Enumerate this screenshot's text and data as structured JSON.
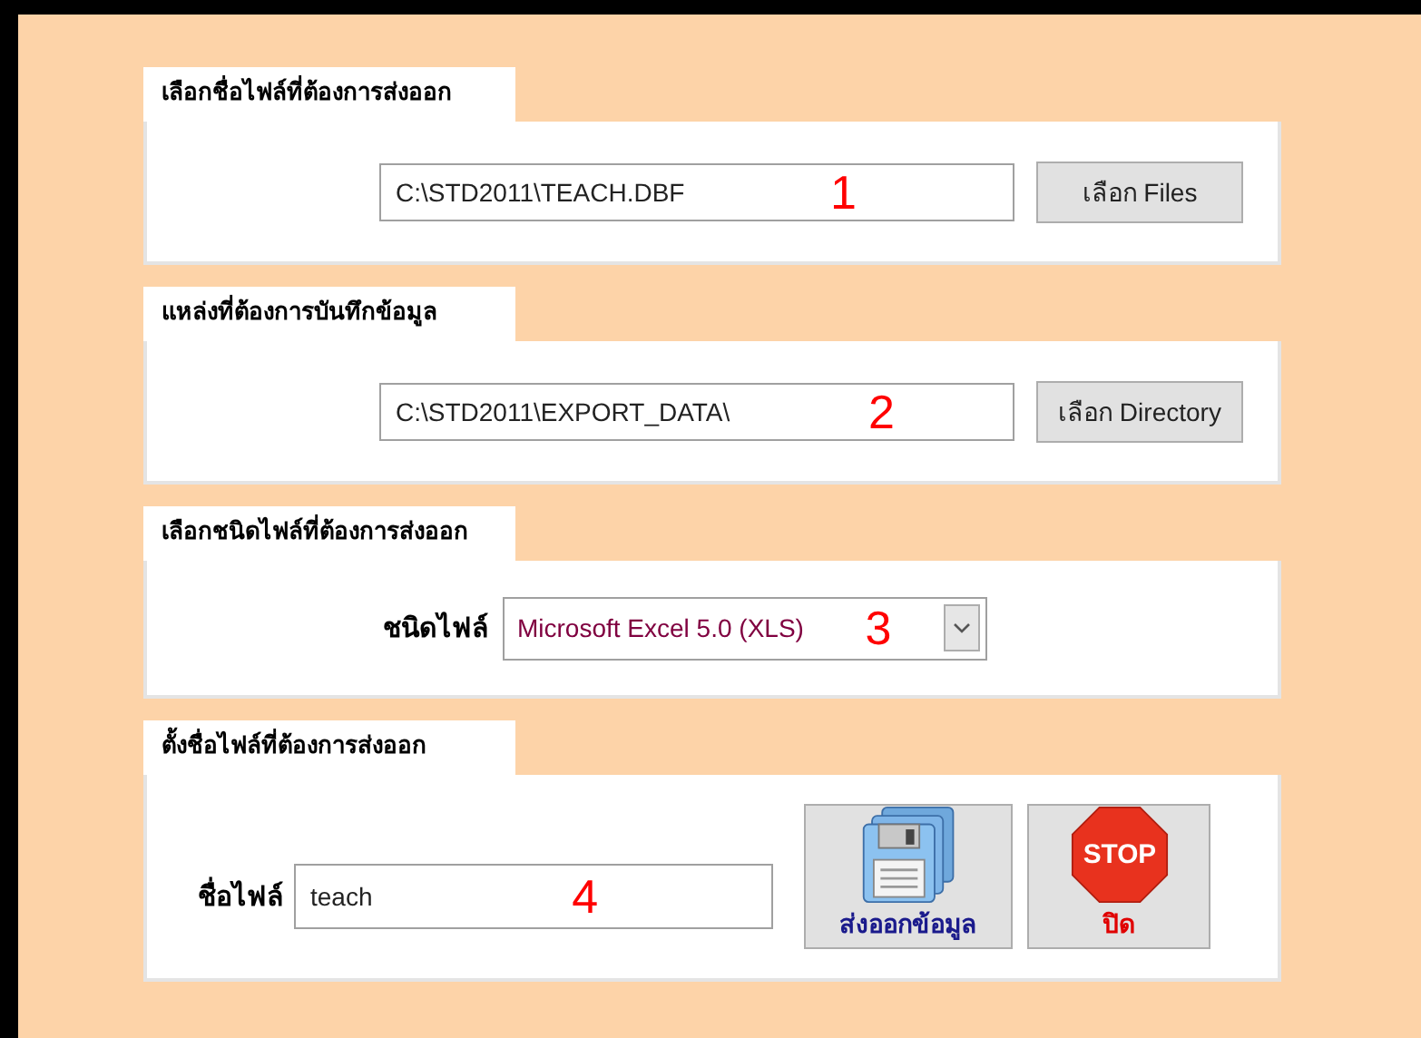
{
  "sections": [
    {
      "kind": "file-field",
      "tab": "เลือกชื่อไฟล์ที่ต้องการส่งออก",
      "value": "C:\\STD2011\\TEACH.DBF",
      "marker": "1",
      "button": "เลือก  Files"
    },
    {
      "kind": "file-field",
      "tab": "แหล่งที่ต้องการบันทึกข้อมูล",
      "value": "C:\\STD2011\\EXPORT_DATA\\",
      "marker": "2",
      "button": "เลือก Directory"
    },
    {
      "kind": "combo",
      "tab": "เลือกชนิดไฟล์ที่ต้องการส่งออก",
      "label": "ชนิดไฟล์",
      "value": "Microsoft Excel 5.0 (XLS)",
      "marker": "3"
    },
    {
      "kind": "name-field",
      "tab": "ตั้งชื่อไฟล์ที่ต้องการส่งออก",
      "label": "ชื่อไฟล์",
      "value": "teach",
      "marker": "4",
      "export_button": "ส่งออกข้อมูล",
      "close_button": "ปิด",
      "stop_sign": "STOP"
    }
  ]
}
